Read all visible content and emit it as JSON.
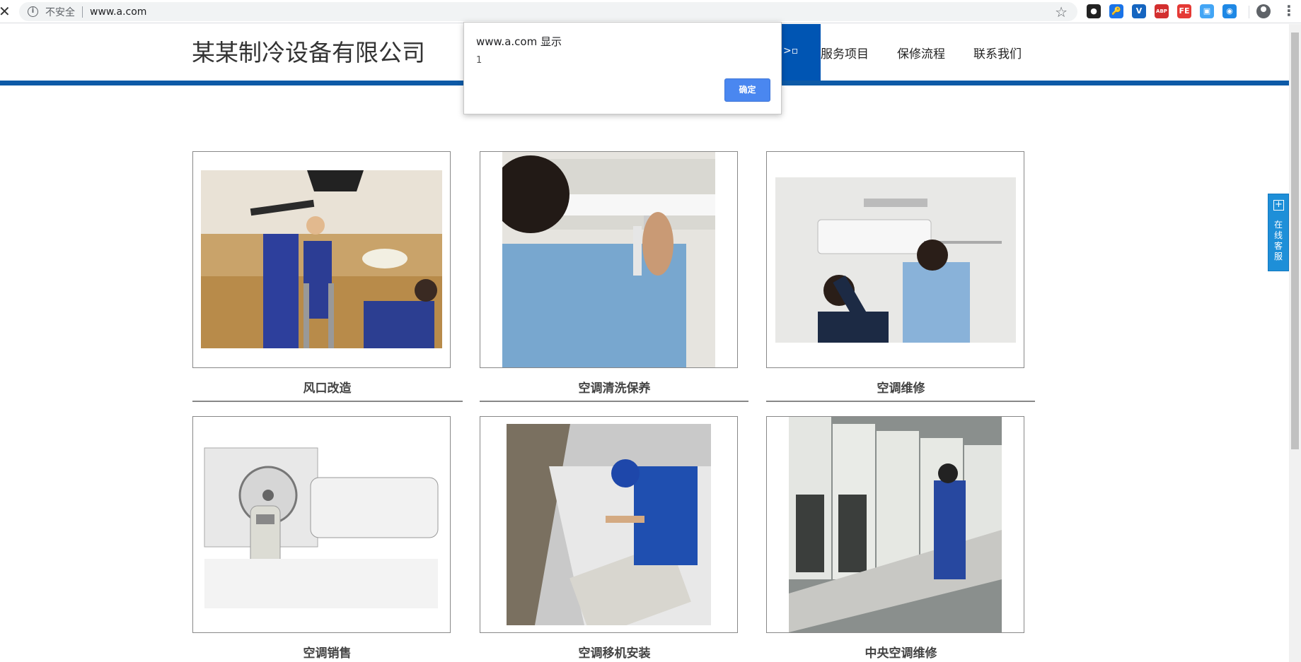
{
  "browser": {
    "insecure_label": "不安全",
    "url": "www.a.com",
    "extensions": [
      {
        "name": "camera-ext-icon",
        "glyph": "●",
        "color": "#222222"
      },
      {
        "name": "key-ext-icon",
        "glyph": "🔑",
        "color": "#1a73e8"
      },
      {
        "name": "v-ext-icon",
        "glyph": "V",
        "color": "#1565c0"
      },
      {
        "name": "abp-ext-icon",
        "glyph": "ABP",
        "color": "#d32f2f"
      },
      {
        "name": "fe-ext-icon",
        "glyph": "FE",
        "color": "#e53935"
      },
      {
        "name": "tv-ext-icon",
        "glyph": "▣",
        "color": "#42a5f5"
      },
      {
        "name": "eye-ext-icon",
        "glyph": "◉",
        "color": "#1e88e5"
      }
    ]
  },
  "header": {
    "company_name": "某某制冷设备有限公司",
    "broken_image_text": ">",
    "nav_items": [
      "服务项目",
      "保修流程",
      "联系我们"
    ],
    "accent_color": "#0d5aa7"
  },
  "services": [
    {
      "caption": "风口改造",
      "photo": "ceiling-vent-repair"
    },
    {
      "caption": "空调清洗保养",
      "photo": "ac-cleaning"
    },
    {
      "caption": "空调维修",
      "photo": "ac-wall-repair"
    },
    {
      "caption": "空调销售",
      "photo": "ac-units-sale"
    },
    {
      "caption": "空调移机安装",
      "photo": "ac-relocation-install"
    },
    {
      "caption": "中央空调维修",
      "photo": "central-ac-repair"
    }
  ],
  "side_service": {
    "label": "在线客服"
  },
  "dialog": {
    "title": "www.a.com 显示",
    "message": "1",
    "ok_label": "确定"
  }
}
